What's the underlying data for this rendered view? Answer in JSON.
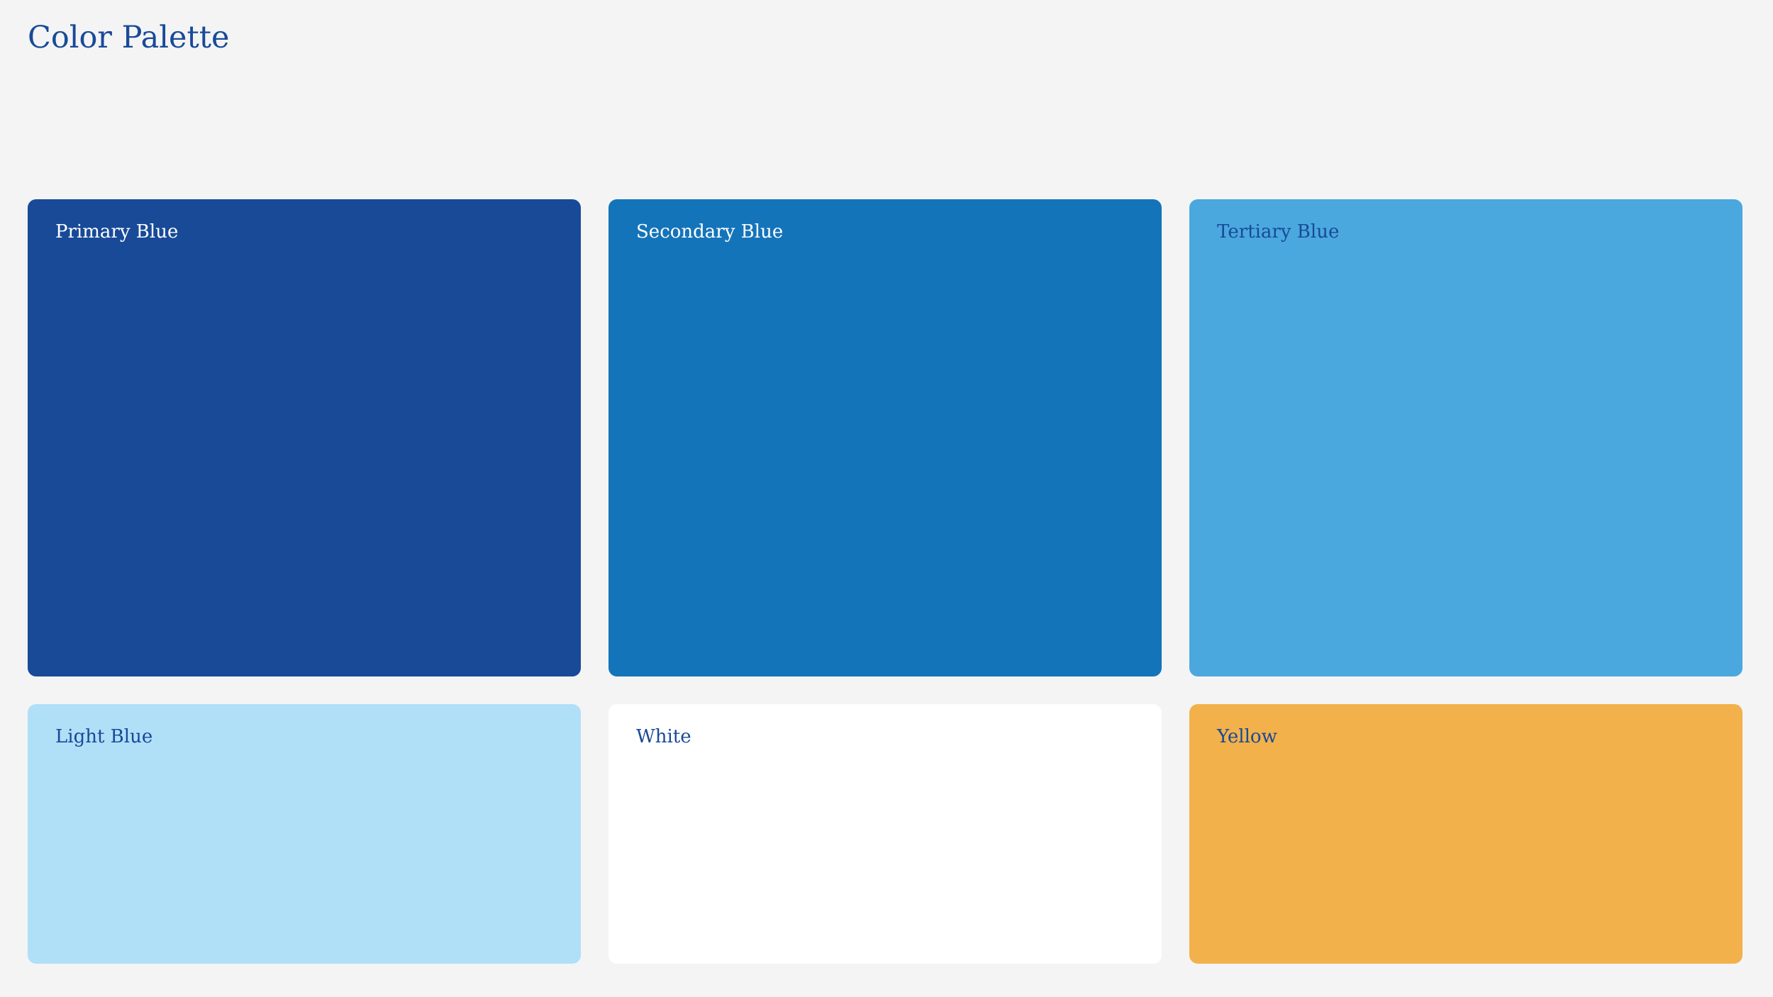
{
  "page": {
    "title": "Color Palette",
    "title_color": "#184a98",
    "background": "#f4f4f4"
  },
  "swatches": [
    {
      "label": "Primary Blue",
      "color": "#184a98",
      "text_color": "#ffffff"
    },
    {
      "label": "Secondary Blue",
      "color": "#1474ba",
      "text_color": "#ffffff"
    },
    {
      "label": "Tertiary Blue",
      "color": "#4aa8df",
      "text_color": "#184a98"
    },
    {
      "label": "Light Blue",
      "color": "#b0dff8",
      "text_color": "#184a98"
    },
    {
      "label": "White",
      "color": "#ffffff",
      "text_color": "#184a98"
    },
    {
      "label": "Yellow",
      "color": "#f2b14a",
      "text_color": "#184a98"
    }
  ]
}
